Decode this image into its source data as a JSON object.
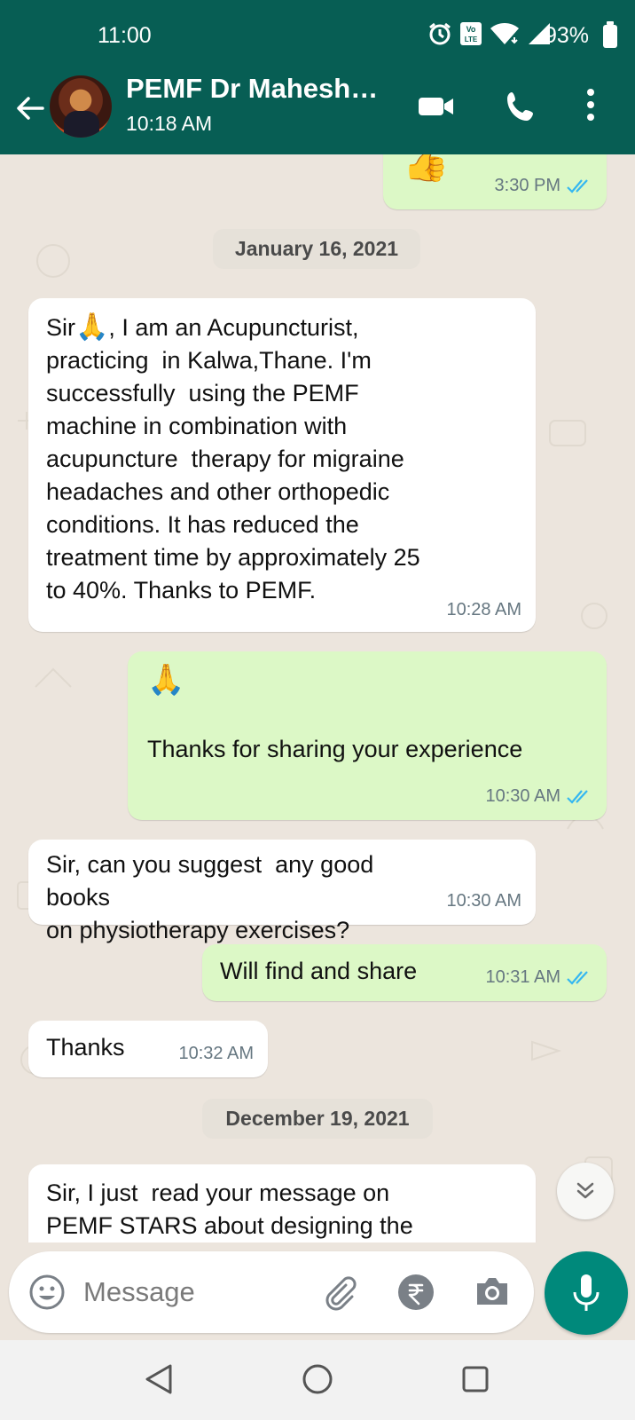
{
  "status_bar": {
    "time": "11:00",
    "battery": "93%",
    "icons": [
      "alarm-icon",
      "volte-icon",
      "wifi-icon",
      "signal-icon",
      "battery-icon"
    ]
  },
  "header": {
    "contact_name": "PEMF Dr Mahesh…",
    "last_seen": "10:18 AM",
    "icons": [
      "back-arrow-icon",
      "video-call-icon",
      "phone-call-icon",
      "more-vert-icon"
    ]
  },
  "chat": {
    "first_partial": {
      "emoji": "👍",
      "time": "3:30 PM"
    },
    "date1": "January 16, 2021",
    "msg1": {
      "text_lead": "Sir",
      "emoji": "🙏",
      "text": ", I am an Acupuncturist,\npracticing  in Kalwa,Thane. I'm\nsuccessfully  using the PEMF\nmachine in combination with\nacupuncture  therapy for migraine\nheadaches and other orthopedic\nconditions. It has reduced the\ntreatment time by approximately 25\nto 40%. Thanks to PEMF.",
      "time": "10:28 AM"
    },
    "msg2": {
      "emoji": "🙏",
      "text": "Thanks for sharing your experience",
      "time": "10:30 AM"
    },
    "msg3": {
      "text": "Sir, can you suggest  any good books\non physiotherapy exercises?",
      "time": "10:30 AM"
    },
    "msg4": {
      "text": "Will find and share",
      "time": "10:31 AM"
    },
    "msg5": {
      "text": "Thanks",
      "time": "10:32 AM"
    },
    "date2": "December 19, 2021",
    "msg6": {
      "text": "Sir, I just  read your message on\nPEMF STARS about designing the"
    }
  },
  "composer": {
    "placeholder": "Message",
    "icons": [
      "emoji-icon",
      "attach-icon",
      "rupee-icon",
      "camera-icon",
      "mic-icon"
    ]
  },
  "colors": {
    "header": "#075e54",
    "outgoing": "#dcf8c6",
    "incoming": "#ffffff",
    "background": "#ece5dd",
    "tick_read": "#34b7f1",
    "mic": "#00897b"
  }
}
